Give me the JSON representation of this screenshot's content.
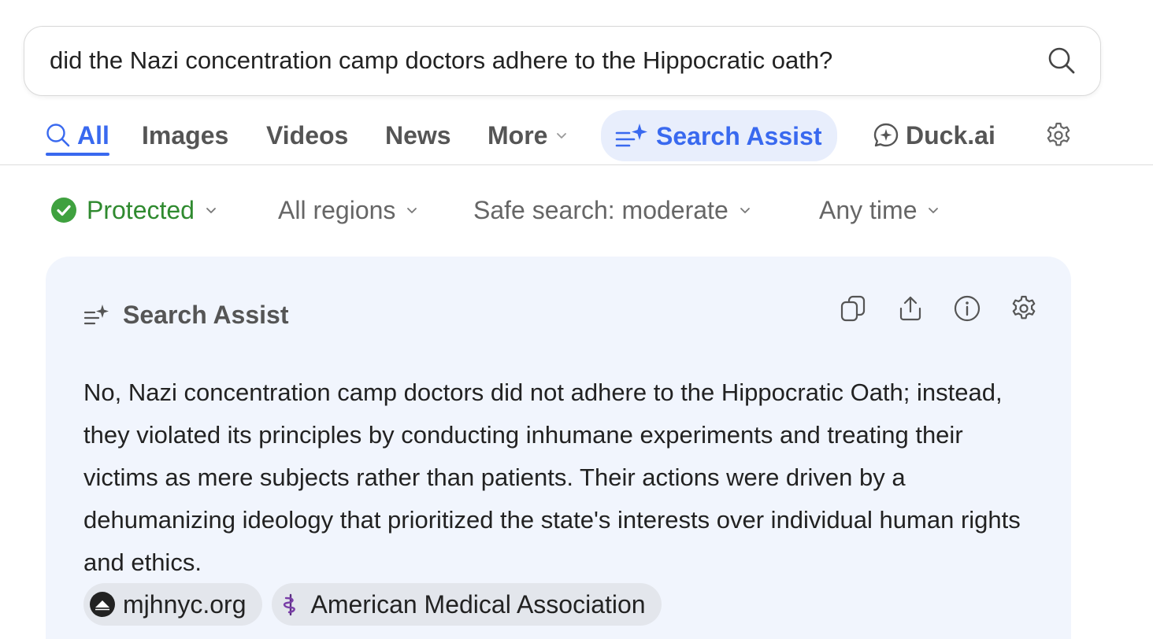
{
  "search": {
    "query": "did the Nazi concentration camp doctors adhere to the Hippocratic oath?"
  },
  "tabs": [
    {
      "label": "All",
      "active": true,
      "icon": "search-icon"
    },
    {
      "label": "Images"
    },
    {
      "label": "Videos"
    },
    {
      "label": "News"
    },
    {
      "label": "More",
      "icon": "chevron-down-icon"
    },
    {
      "label": "Search Assist",
      "icon": "assist-sparkle-icon",
      "highlighted": true
    },
    {
      "label": "Duck.ai",
      "icon": "chat-sparkle-icon"
    }
  ],
  "filters": {
    "protected": "Protected",
    "regions": "All regions",
    "safe_search": "Safe search: moderate",
    "time": "Any time"
  },
  "assist": {
    "title": "Search Assist",
    "answer": "No, Nazi concentration camp doctors did not adhere to the Hippocratic Oath; instead, they violated its principles by conducting inhumane experiments and treating their victims as mere subjects rather than patients. Their actions were driven by a dehumanizing ideology that prioritized the state's interests over individual human rights and ethics.",
    "sources": [
      {
        "label": "mjhnyc.org",
        "icon": "mjh-logo-icon"
      },
      {
        "label": "American Medical Association",
        "icon": "ama-logo-icon"
      }
    ]
  },
  "colors": {
    "accent": "#3969ef",
    "protected_green": "#2f8a2f",
    "card_background": "#f1f5fd"
  }
}
